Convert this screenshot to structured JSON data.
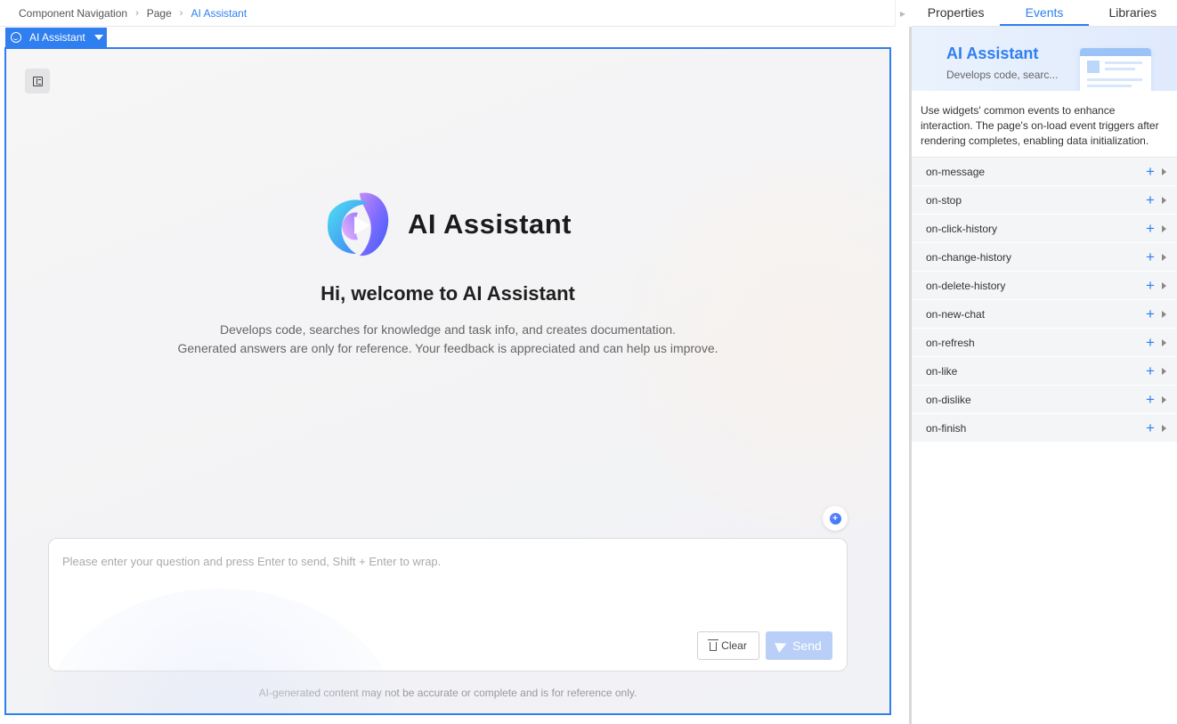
{
  "breadcrumb": {
    "items": [
      "Component Navigation",
      "Page",
      "AI Assistant"
    ],
    "separator": ">"
  },
  "canvas": {
    "component_tag": "AI Assistant",
    "hero_title": "AI Assistant",
    "welcome": "Hi, welcome to AI Assistant",
    "description_line1": "Develops code, searches for knowledge and task info, and creates documentation.",
    "description_line2": "Generated answers are only for reference. Your feedback is appreciated and can help us improve.",
    "input_placeholder": "Please enter your question and press Enter to send, Shift + Enter to wrap.",
    "input_value": "",
    "clear_label": "Clear",
    "send_label": "Send",
    "disclaimer": "AI-generated content may not be accurate or complete and is for reference only."
  },
  "panel": {
    "tabs": [
      {
        "label": "Properties",
        "active": false
      },
      {
        "label": "Events",
        "active": true
      },
      {
        "label": "Libraries",
        "active": false
      }
    ],
    "banner_title": "AI Assistant",
    "banner_subtitle": "Develops code, searc...",
    "intro": "Use widgets' common events to enhance interaction. The page's on-load event triggers after rendering completes, enabling data initialization.",
    "events": [
      "on-message",
      "on-stop",
      "on-click-history",
      "on-change-history",
      "on-delete-history",
      "on-new-chat",
      "on-refresh",
      "on-like",
      "on-dislike",
      "on-finish"
    ]
  },
  "icons": {
    "tag": "smile-icon",
    "history": "history-list-icon",
    "float": "new-chat-icon",
    "clear": "trash-icon",
    "send": "paper-plane-icon",
    "event_add": "plus-icon",
    "event_expand": "chevron-right-icon"
  },
  "colors": {
    "accent": "#2f7ff0",
    "send_disabled": "#b9cff8",
    "event_row": "#f4f5f7"
  }
}
